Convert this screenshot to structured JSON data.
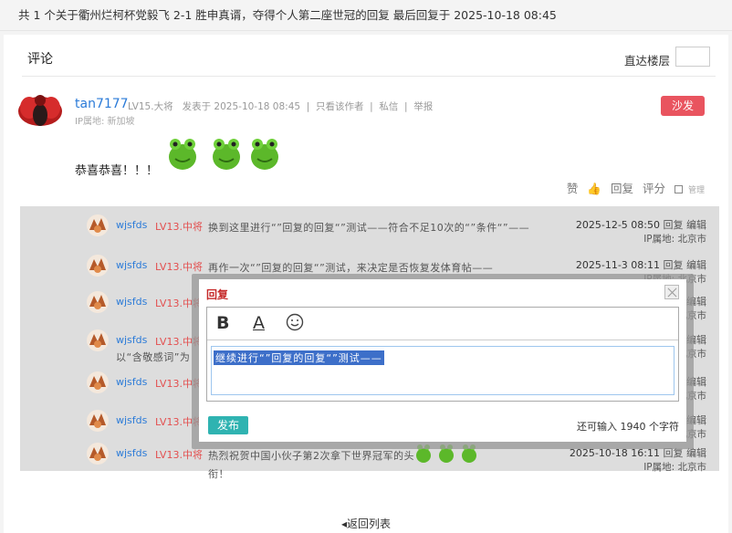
{
  "topbar": {
    "text": "共 1 个关于衢州烂柯杯党毅飞 2-1 胜申真谞，夺得个人第二座世冠的回复 最后回复于 2025-10-18 08:45"
  },
  "comments": {
    "title": "评论",
    "jump_label": "直达楼层",
    "jump_value": ""
  },
  "post": {
    "user": "tan7177",
    "level": "LV15.大将",
    "posted": "发表于 2025-10-18 08:45",
    "only_author": "只看该作者",
    "pm": "私信",
    "report": "举报",
    "ip": "IP属地: 新加坡",
    "sofa": "沙发",
    "content": "恭喜恭喜！！！",
    "like": "赞",
    "reply": "回复",
    "rate": "评分",
    "manage": "管理",
    "emoji_count": 3
  },
  "replies": [
    {
      "user": "wjsfds",
      "level": "LV13.中将",
      "text": "换到这里进行“”回复的回复“”测试——符合不足10次的“”条件“”——",
      "date": "2025-12-5 08:50",
      "reply": "回复",
      "edit": "编辑",
      "ip": "IP属地: 北京市"
    },
    {
      "user": "wjsfds",
      "level": "LV13.中将",
      "text": "再作一次“”回复的回复“”测试，来决定是否恢复发体育帖——",
      "date": "2025-11-3 08:11",
      "reply": "回复",
      "edit": "编辑",
      "ip": "IP属地: 北京市"
    },
    {
      "user": "wjsfds",
      "level": "LV13.中将",
      "text": "",
      "date": "",
      "reply": "",
      "edit": "编辑",
      "ip": "北京市"
    },
    {
      "user": "wjsfds",
      "level": "LV13.中将",
      "text": "以“含敬感词”为",
      "date": "",
      "reply": "",
      "edit": "编辑",
      "ip": "北京市"
    },
    {
      "user": "wjsfds",
      "level": "LV13.中将",
      "text": "",
      "date": "",
      "reply": "",
      "edit": "编辑",
      "ip": "北京市"
    },
    {
      "user": "wjsfds",
      "level": "LV13.中将",
      "text": "",
      "date": "",
      "reply": "",
      "edit": "编辑",
      "ip": "北京市"
    },
    {
      "user": "wjsfds",
      "level": "LV13.中将",
      "text": "热烈祝贺中国小伙子第2次拿下世界冠军的头衔！",
      "date": "2025-10-18 16:11",
      "reply": "回复",
      "edit": "编辑",
      "ip": "IP属地: 北京市"
    }
  ],
  "back_link": "◂返回列表",
  "modal": {
    "title": "回复",
    "bold": "B",
    "font_color": "A",
    "selected_text": "继续进行“”回复的回复“”测试——",
    "publish": "发布",
    "remaining": "还可输入 1940 个字符"
  },
  "colors": {
    "link_blue": "#2b7bd8",
    "sofa_red": "#e9545f",
    "level_red": "#e35050",
    "publish_teal": "#2fb3b1",
    "selection_blue": "#3d6fc9"
  }
}
